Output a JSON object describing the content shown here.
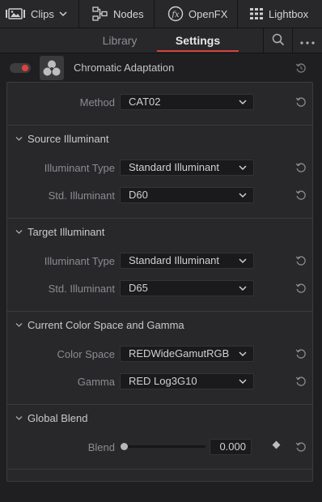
{
  "toolbar": {
    "clips_label": "Clips",
    "nodes_label": "Nodes",
    "openfx_label": "OpenFX",
    "lightbox_label": "Lightbox"
  },
  "tabs": {
    "library": "Library",
    "settings": "Settings"
  },
  "effect": {
    "title": "Chromatic Adaptation",
    "enabled": true
  },
  "method": {
    "label": "Method",
    "value": "CAT02"
  },
  "source_illuminant": {
    "title": "Source Illuminant",
    "type_label": "Illuminant Type",
    "type_value": "Standard Illuminant",
    "std_label": "Std. Illuminant",
    "std_value": "D60"
  },
  "target_illuminant": {
    "title": "Target Illuminant",
    "type_label": "Illuminant Type",
    "type_value": "Standard Illuminant",
    "std_label": "Std. Illuminant",
    "std_value": "D65"
  },
  "color_space": {
    "title": "Current Color Space and Gamma",
    "space_label": "Color Space",
    "space_value": "REDWideGamutRGB",
    "gamma_label": "Gamma",
    "gamma_value": "RED Log3G10"
  },
  "global_blend": {
    "title": "Global Blend",
    "blend_label": "Blend",
    "blend_value": "0.000",
    "blend_fraction": 0.0
  },
  "colors": {
    "accent": "#d5423c",
    "panel_bg": "#28282b",
    "app_bg": "#1f1f21"
  }
}
